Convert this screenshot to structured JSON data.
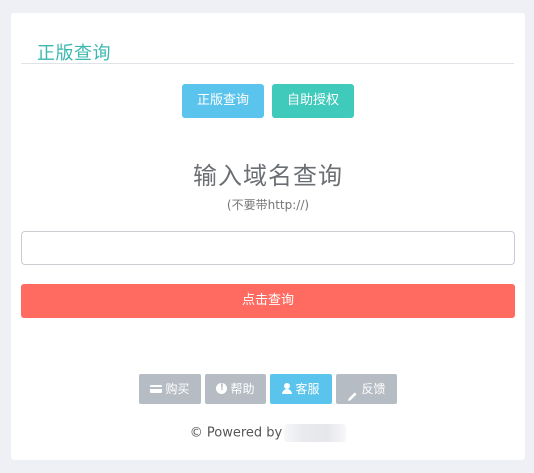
{
  "card": {
    "title": "正版查询"
  },
  "tabs": {
    "query_label": "正版查询",
    "auth_label": "自助授权"
  },
  "form": {
    "heading": "输入域名查询",
    "hint": "(不要带http://)",
    "input_value": "",
    "input_placeholder": "",
    "submit_label": "点击查询"
  },
  "actions": {
    "buy_label": "购买",
    "help_label": "帮助",
    "service_label": "客服",
    "feedback_label": "反馈"
  },
  "footer": {
    "text": "© Powered by"
  },
  "colors": {
    "accent_teal": "#3cb8b0",
    "tab_blue": "#5bc4ec",
    "tab_teal": "#3fcabc",
    "submit_red": "#ff6b61",
    "muted_gray": "#b6bcc3"
  }
}
